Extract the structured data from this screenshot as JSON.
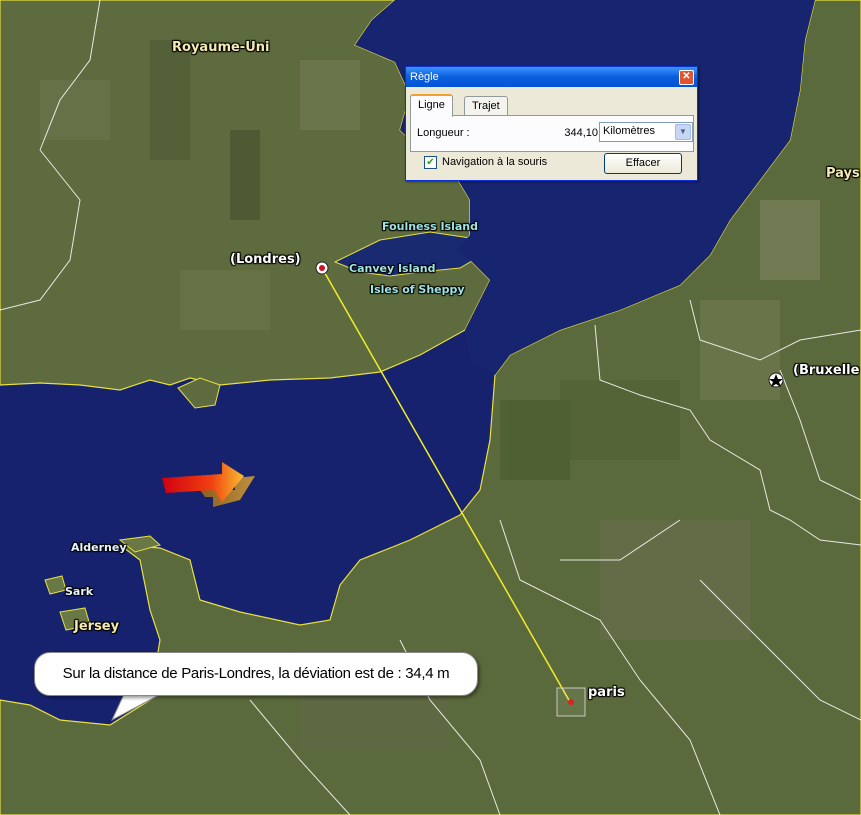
{
  "map": {
    "labels": {
      "uk": "Royaume-Uni",
      "london": "(Londres)",
      "foulness": "Foulness Island",
      "canvey": "Canvey Island",
      "sheppey": "Isles of Sheppy",
      "brussels": "(Bruxelle",
      "paysbas": "Pays",
      "alderney": "Alderney",
      "sark": "Sark",
      "jersey": "Jersey",
      "paris": "paris"
    },
    "colors": {
      "sea": "#16226e",
      "land": "#5c6a3a",
      "coastline": "#e8e040",
      "border": "#ffffff",
      "ruler_line": "#f2ee2a"
    },
    "icons": [
      "london-marker-icon",
      "brussels-star-icon",
      "paris-target-icon",
      "arrow-3d-icon"
    ]
  },
  "ruler": {
    "title": "Règle",
    "close": "✕",
    "tabs": [
      "Ligne",
      "Trajet"
    ],
    "length_label": "Longueur :",
    "length_value": "344,10",
    "unit": "Kilomètres",
    "mouse_nav_label": "Navigation à la souris",
    "mouse_nav_checked": true,
    "clear_button": "Effacer"
  },
  "callout": {
    "text": "Sur la distance de Paris-Londres, la déviation est de : 34,4 m"
  }
}
